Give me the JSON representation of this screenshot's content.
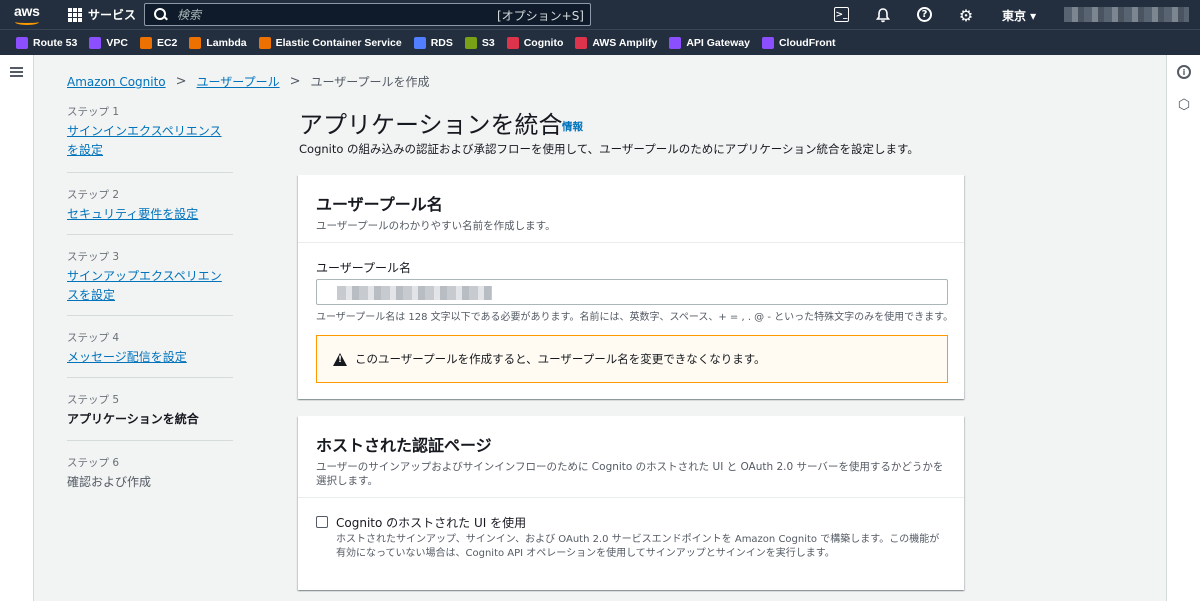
{
  "topnav": {
    "services_label": "サービス",
    "search_placeholder": "検索",
    "search_shortcut": "[オプション+S]",
    "region": "東京 ▾"
  },
  "favorites": [
    {
      "label": "Route 53",
      "color": "#8c4fff"
    },
    {
      "label": "VPC",
      "color": "#8c4fff"
    },
    {
      "label": "EC2",
      "color": "#ed7100"
    },
    {
      "label": "Lambda",
      "color": "#ed7100"
    },
    {
      "label": "Elastic Container Service",
      "color": "#ed7100"
    },
    {
      "label": "RDS",
      "color": "#527fff"
    },
    {
      "label": "S3",
      "color": "#7aa116"
    },
    {
      "label": "Cognito",
      "color": "#dd344c"
    },
    {
      "label": "AWS Amplify",
      "color": "#dd344c"
    },
    {
      "label": "API Gateway",
      "color": "#8c4fff"
    },
    {
      "label": "CloudFront",
      "color": "#8c4fff"
    }
  ],
  "breadcrumb": {
    "item1": "Amazon Cognito",
    "item2": "ユーザープール",
    "current": "ユーザープールを作成"
  },
  "steps": [
    {
      "num": "ステップ 1",
      "label": "サインインエクスペリエンスを設定"
    },
    {
      "num": "ステップ 2",
      "label": "セキュリティ要件を設定"
    },
    {
      "num": "ステップ 3",
      "label": "サインアップエクスペリエンスを設定"
    },
    {
      "num": "ステップ 4",
      "label": "メッセージ配信を設定"
    },
    {
      "num": "ステップ 5",
      "label": "アプリケーションを統合"
    },
    {
      "num": "ステップ 6",
      "label": "確認および作成"
    }
  ],
  "main": {
    "title": "アプリケーションを統合",
    "info": "情報",
    "description": "Cognito の組み込みの認証および承認フローを使用して、ユーザープールのためにアプリケーション統合を設定します。"
  },
  "pool_name_card": {
    "heading": "ユーザープール名",
    "subheading": "ユーザープールのわかりやすい名前を作成します。",
    "field_label": "ユーザープール名",
    "hint": "ユーザープール名は 128 文字以下である必要があります。名前には、英数字、スペース、+ = , . @ - といった特殊文字のみを使用できます。",
    "warning": "このユーザープールを作成すると、ユーザープール名を変更できなくなります。"
  },
  "hosted_ui_card": {
    "heading": "ホストされた認証ページ",
    "subheading": "ユーザーのサインアップおよびサインインフローのために Cognito のホストされた UI と OAuth 2.0 サーバーを使用するかどうかを選択します。",
    "checkbox_label": "Cognito のホストされた UI を使用",
    "checkbox_checked": false,
    "checkbox_desc": "ホストされたサインアップ、サインイン、および OAuth 2.0 サービスエンドポイントを Amazon Cognito で構築します。この機能が有効になっていない場合は、Cognito API オペレーションを使用してサインアップとサインインを実行します。"
  }
}
